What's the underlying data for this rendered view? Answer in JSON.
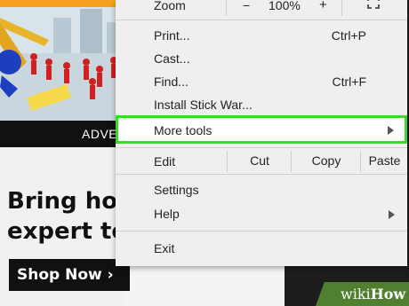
{
  "background_page": {
    "ad_label": "ADVE",
    "headline_line1": "Bring ho",
    "headline_line2": "expert to",
    "shop_button": "Shop Now",
    "shop_button_chevron": "›"
  },
  "menu": {
    "zoom": {
      "label": "Zoom",
      "minus": "−",
      "value": "100%",
      "plus": "+",
      "fullscreen_icon": "fullscreen-icon"
    },
    "items": [
      {
        "label": "Print...",
        "shortcut": "Ctrl+P"
      },
      {
        "label": "Cast...",
        "shortcut": ""
      },
      {
        "label": "Find...",
        "shortcut": "Ctrl+F"
      },
      {
        "label": "Install Stick War...",
        "shortcut": ""
      }
    ],
    "more_tools": {
      "label": "More tools",
      "icon": "submenu-arrow-icon",
      "highlight_color": "#3bd62f"
    },
    "edit": {
      "label": "Edit",
      "cut": "Cut",
      "copy": "Copy",
      "paste": "Paste"
    },
    "settings": "Settings",
    "help": {
      "label": "Help",
      "icon": "submenu-arrow-icon"
    },
    "exit": "Exit"
  },
  "watermark": {
    "wiki": "wiki",
    "how": "How"
  }
}
